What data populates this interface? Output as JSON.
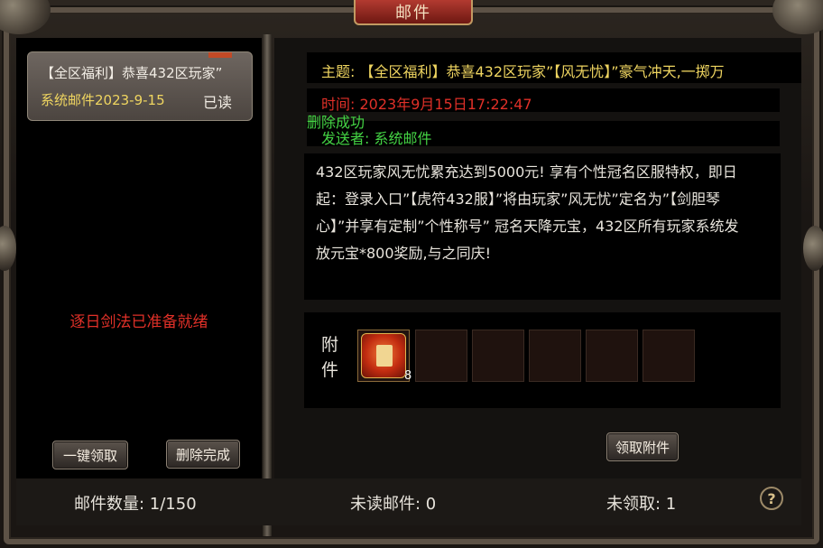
{
  "window": {
    "title": "邮件"
  },
  "mail_list": {
    "items": [
      {
        "subject": "【全区福利】恭喜432区玩家”",
        "date_label": "系统邮件2023-9-15",
        "status": "已读"
      }
    ],
    "buttons": {
      "claim_all": "一键领取",
      "delete_done": "删除完成"
    }
  },
  "notice": "逐日剑法已准备就绪",
  "mail_detail": {
    "subject": "主题: 【全区福利】恭喜432区玩家”【风无忧】”豪气冲天,一掷万",
    "time": "时间: 2023年9月15日17:22:47",
    "toast": "删除成功",
    "sender": "发送者: 系统邮件",
    "body": "432区玩家风无忧累充达到5000元! 享有个性冠名区服特权，即日起：登录入口”【虎符432服】”将由玩家”风无忧”定名为”【剑胆琴心】”并享有定制”个性称号” 冠名天降元宝，432区所有玩家系统发放元宝*800奖励,与之同庆!",
    "attachment_label": "附件",
    "attachments": [
      {
        "icon": "red-token-icon",
        "count": "8"
      }
    ],
    "empty_slots": 5,
    "claim_button": "领取附件"
  },
  "footer": {
    "mail_count": "邮件数量: 1/150",
    "unread": "未读邮件: 0",
    "unclaimed": "未领取: 1",
    "help": "?"
  }
}
